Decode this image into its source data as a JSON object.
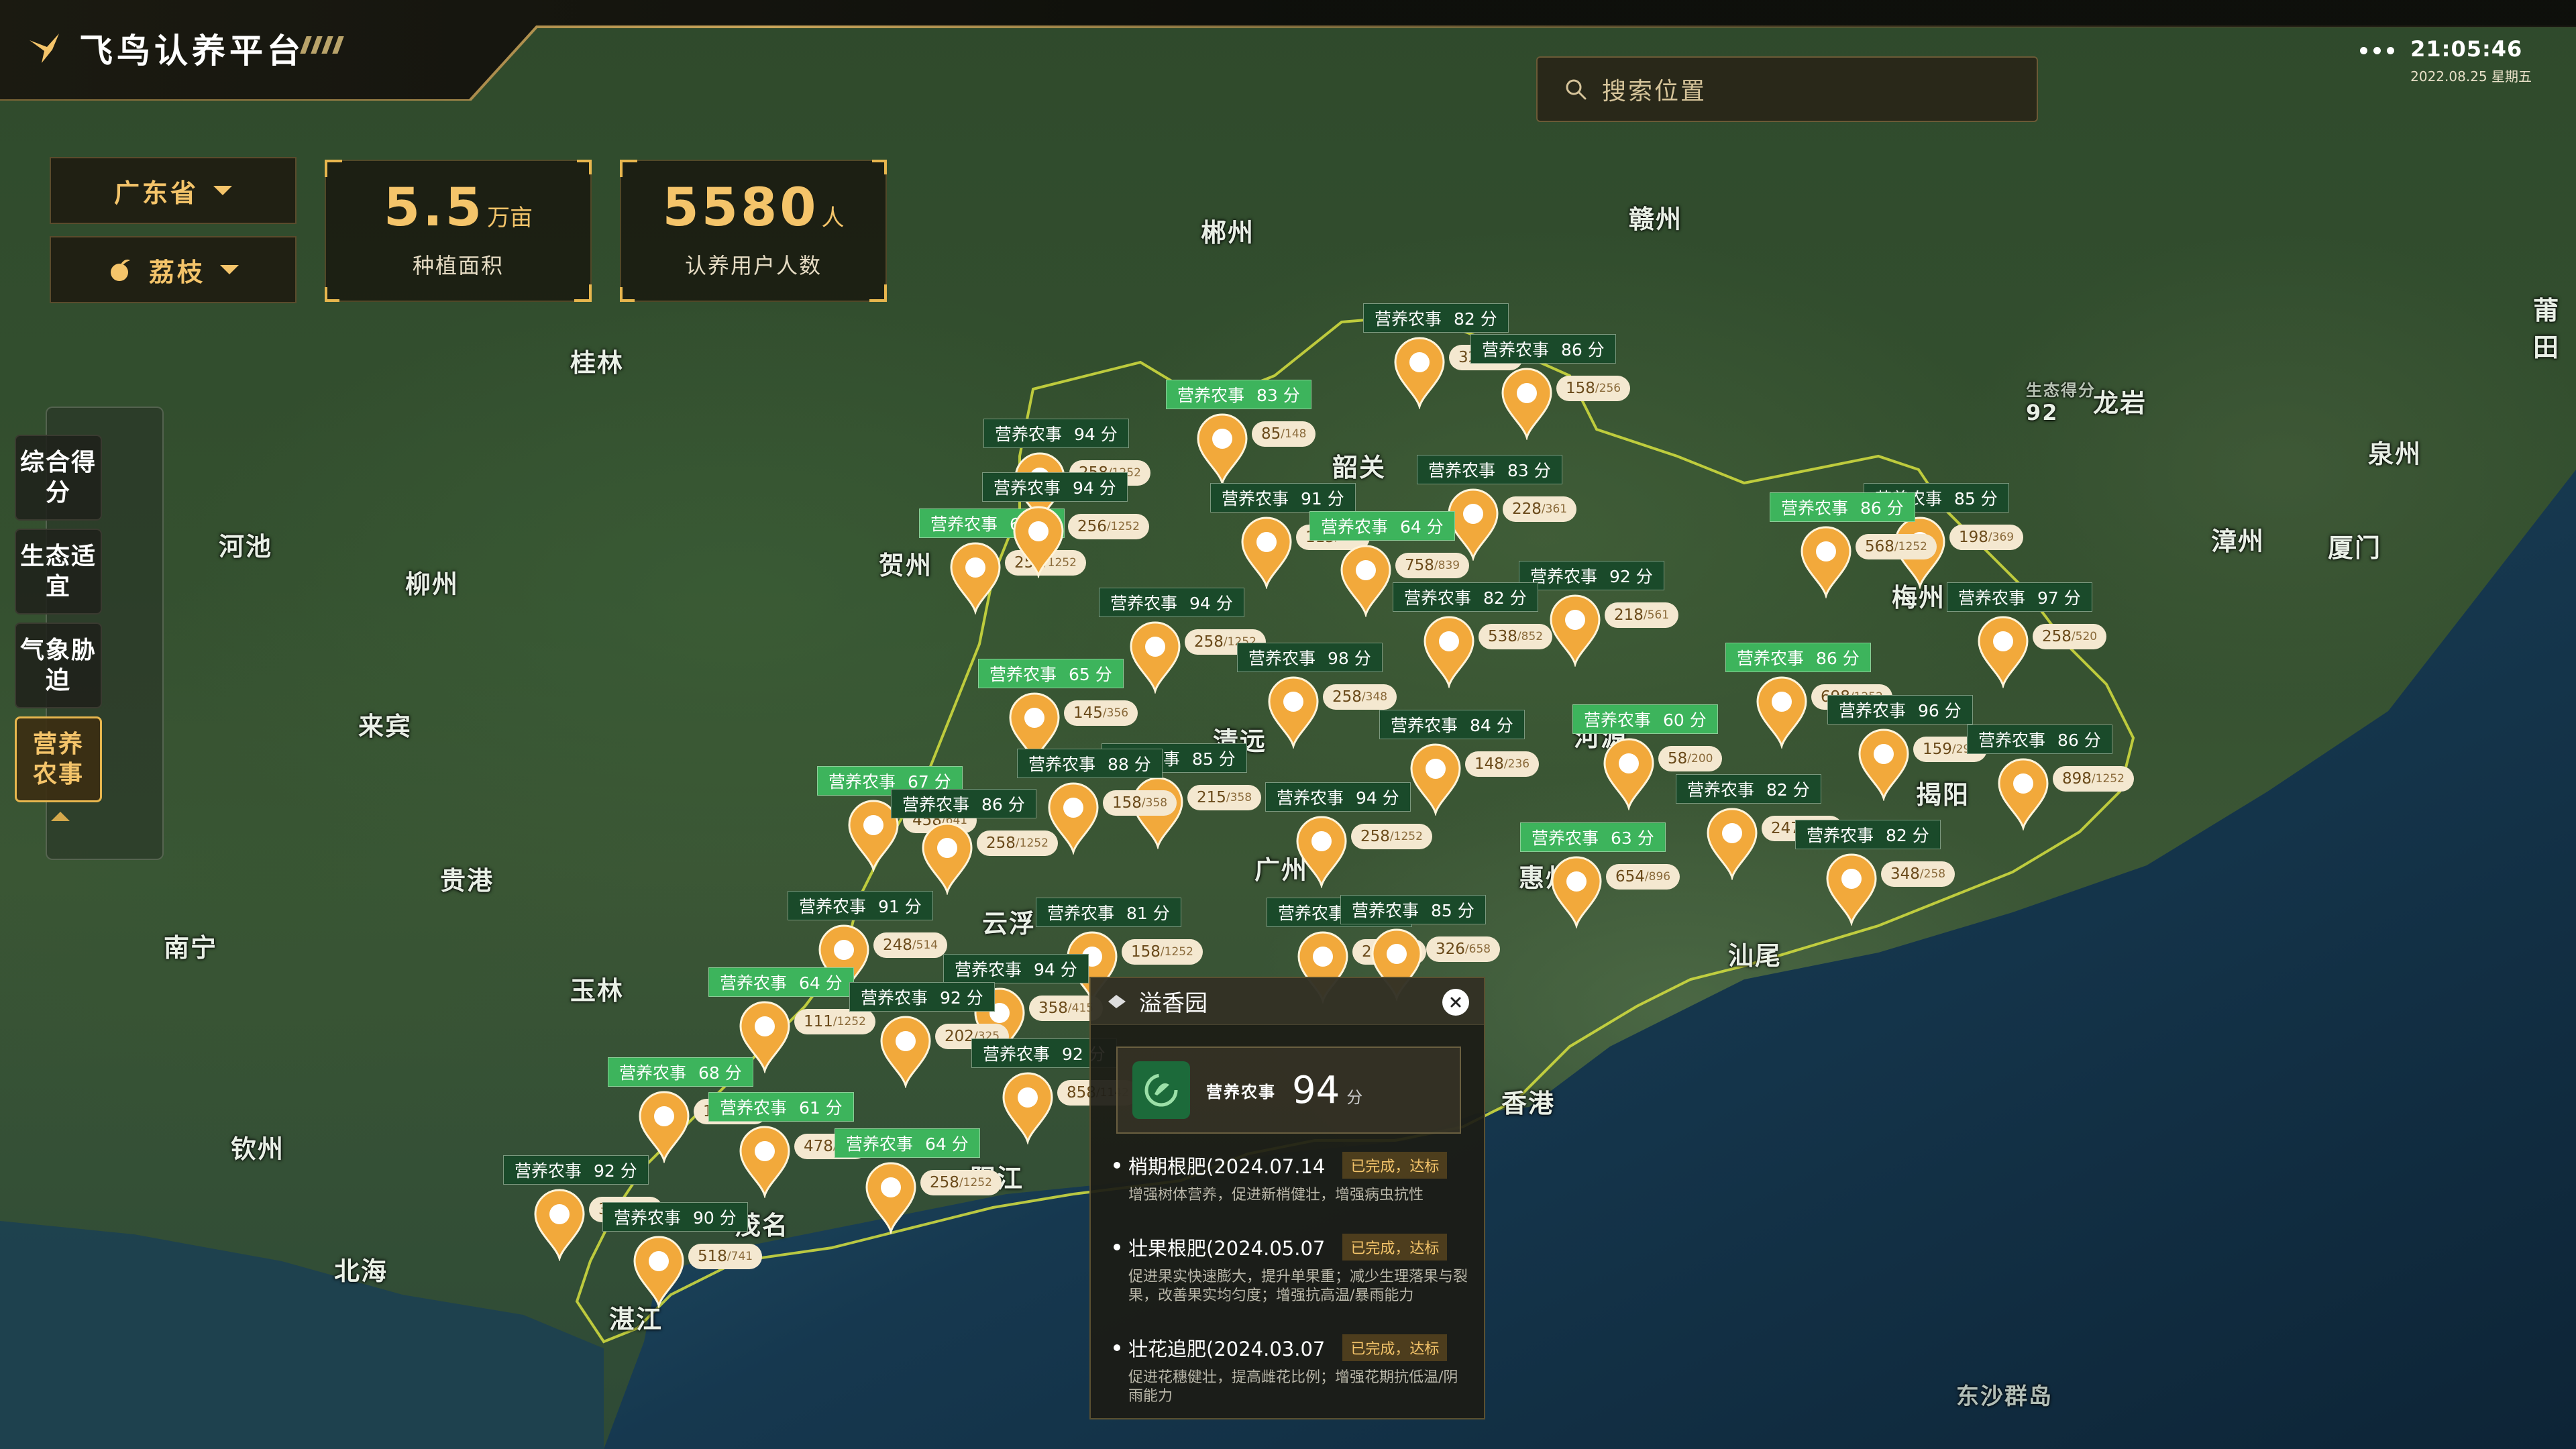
{
  "app": {
    "title": "飞鸟认养平台"
  },
  "search": {
    "placeholder": "搜索位置"
  },
  "clock": {
    "time": "21:05:46",
    "date": "2022.08.25 星期五"
  },
  "filters": {
    "province": "广东省",
    "crop": "荔枝"
  },
  "stats": [
    {
      "value": "5.5",
      "unit": "万亩",
      "label": "种植面积"
    },
    {
      "value": "5580",
      "unit": "人",
      "label": "认养用户人数"
    }
  ],
  "nav": [
    {
      "label": "综合得分",
      "active": false
    },
    {
      "label": "生态适宜",
      "active": false
    },
    {
      "label": "气象胁迫",
      "active": false
    },
    {
      "label": "营养农事",
      "active": true
    }
  ],
  "map": {
    "cities": [
      "郴州",
      "赣州",
      "莆田",
      "桂林",
      "河池",
      "柳州",
      "贺州",
      "韶关",
      "龙岩",
      "泉州",
      "漳州",
      "厦门",
      "梅州",
      "揭阳",
      "河源",
      "清远",
      "广州",
      "惠州",
      "汕尾",
      "云浮",
      "阳江",
      "茂名",
      "湛江",
      "来宾",
      "贵港",
      "南宁",
      "玉林",
      "钦州",
      "北海",
      "香港",
      "东沙群岛",
      "生态得分",
      "92"
    ],
    "tag_prefix": "营养农事",
    "score_unit": "分",
    "markers": [
      {
        "score": 82,
        "count": "324/450",
        "style": "dark"
      },
      {
        "score": 86,
        "count": "158/256",
        "style": "dark"
      },
      {
        "score": 83,
        "count": "85/148",
        "style": "light"
      },
      {
        "score": 83,
        "count": "228/361",
        "style": "dark"
      },
      {
        "score": 94,
        "count": "258/1252",
        "style": "dark"
      },
      {
        "score": 63,
        "count": "258/1252",
        "style": "light"
      },
      {
        "score": 91,
        "count": "115/458",
        "style": "dark"
      },
      {
        "score": 64,
        "count": "758/839",
        "style": "light"
      },
      {
        "score": 94,
        "count": "256/1252",
        "style": "dark"
      },
      {
        "score": 85,
        "count": "198/369",
        "style": "dark"
      },
      {
        "score": 86,
        "count": "568/1252",
        "style": "light"
      },
      {
        "score": 92,
        "count": "218/561",
        "style": "dark"
      },
      {
        "score": 82,
        "count": "538/852",
        "style": "dark"
      },
      {
        "score": 94,
        "count": "258/1252",
        "style": "dark"
      },
      {
        "score": 97,
        "count": "258/520",
        "style": "dark"
      },
      {
        "score": 98,
        "count": "258/348",
        "style": "dark"
      },
      {
        "score": 86,
        "count": "698/1252",
        "style": "light"
      },
      {
        "score": 65,
        "count": "145/356",
        "style": "light"
      },
      {
        "score": 84,
        "count": "148/236",
        "style": "dark"
      },
      {
        "score": 60,
        "count": "58/200",
        "style": "light"
      },
      {
        "score": 96,
        "count": "159/298",
        "style": "dark"
      },
      {
        "score": 86,
        "count": "898/1252",
        "style": "dark"
      },
      {
        "score": 85,
        "count": "215/358",
        "style": "dark"
      },
      {
        "score": 67,
        "count": "458/641",
        "style": "light"
      },
      {
        "score": 86,
        "count": "258/1252",
        "style": "dark"
      },
      {
        "score": 82,
        "count": "247/1252",
        "style": "dark"
      },
      {
        "score": 88,
        "count": "158/358",
        "style": "dark"
      },
      {
        "score": 94,
        "count": "258/1252",
        "style": "dark"
      },
      {
        "score": 63,
        "count": "654/896",
        "style": "light"
      },
      {
        "score": 82,
        "count": "348/258",
        "style": "dark"
      },
      {
        "score": 91,
        "count": "248/514",
        "style": "dark"
      },
      {
        "score": 81,
        "count": "158/1252",
        "style": "dark"
      },
      {
        "score": 96,
        "count": "201/324",
        "style": "dark"
      },
      {
        "score": 85,
        "count": "326/658",
        "style": "dark"
      },
      {
        "score": 64,
        "count": "111/1252",
        "style": "light"
      },
      {
        "score": 94,
        "count": "358/415",
        "style": "dark"
      },
      {
        "score": 92,
        "count": "202/325",
        "style": "dark"
      },
      {
        "score": 68,
        "count": "147/859",
        "style": "light"
      },
      {
        "score": 92,
        "count": "858/1142",
        "style": "dark"
      },
      {
        "score": 61,
        "count": "478/859",
        "style": "light"
      },
      {
        "score": 64,
        "count": "258/1252",
        "style": "light"
      },
      {
        "score": 92,
        "count": "328/512",
        "style": "dark"
      },
      {
        "score": 90,
        "count": "518/741",
        "style": "dark"
      }
    ]
  },
  "popup": {
    "title": "溢香园",
    "score_label": "营养农事",
    "score": "94",
    "score_unit": "分",
    "activities": [
      {
        "name": "梢期根肥(2024.07.14",
        "status": "已完成，达标",
        "desc": "增强树体营养，促进新梢健壮，增强病虫抗性"
      },
      {
        "name": "壮果根肥(2024.05.07",
        "status": "已完成，达标",
        "desc": "促进果实快速膨大，提升单果重；减少生理落果与裂果，改善果实均匀度；增强抗高温/暴雨能力"
      },
      {
        "name": "壮花追肥(2024.03.07",
        "status": "已完成，达标",
        "desc": "促进花穗健壮，提高雌花比例；增强花期抗低温/阴雨能力"
      }
    ]
  },
  "colors": {
    "accent": "#f4c46a",
    "tag_dark": "#1a4a2a",
    "tag_light": "#3db45c",
    "pin": "#f2a93b"
  }
}
